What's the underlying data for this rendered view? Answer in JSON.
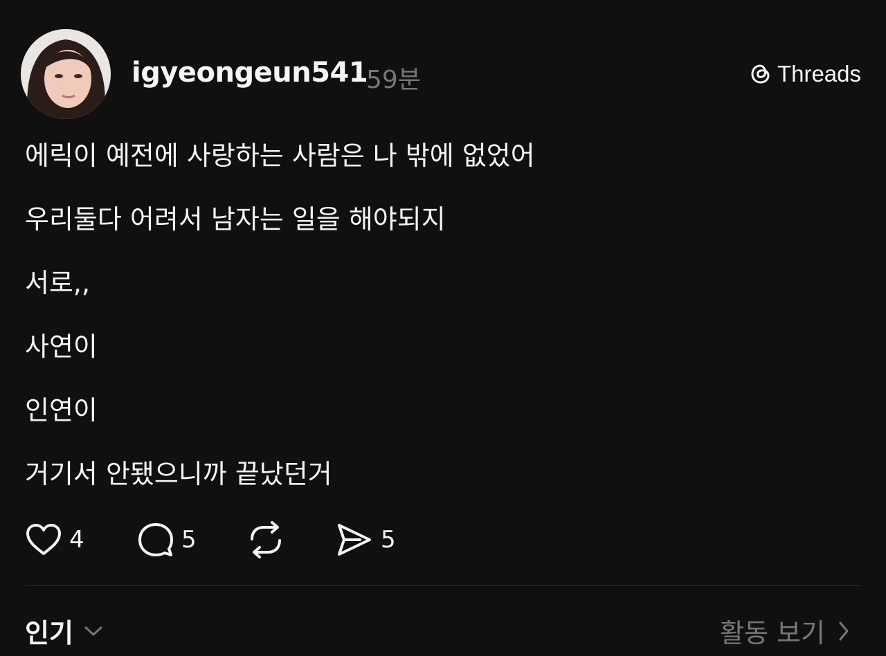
{
  "post": {
    "username": "igyeongeun541",
    "time": "59분",
    "brand": "Threads",
    "lines": [
      "에릭이 예전에 사랑하는 사람은 나 밖에 없었어",
      "우리둘다 어려서 남자는 일을 해야되지",
      "서로,,",
      "사연이",
      "인연이",
      "거기서 안됐으니까 끝났던거"
    ]
  },
  "actions": {
    "like": {
      "icon": "heart-icon",
      "count": "4"
    },
    "comment": {
      "icon": "comment-icon",
      "count": "5"
    },
    "repost": {
      "icon": "repost-icon"
    },
    "share": {
      "icon": "send-icon",
      "count": "5"
    }
  },
  "footer": {
    "sort_label": "인기",
    "activity_label": "활동 보기"
  },
  "colors": {
    "background": "#101010",
    "text_primary": "#f3f5f7",
    "text_secondary": "#777777",
    "divider": "#2c2c2c"
  }
}
